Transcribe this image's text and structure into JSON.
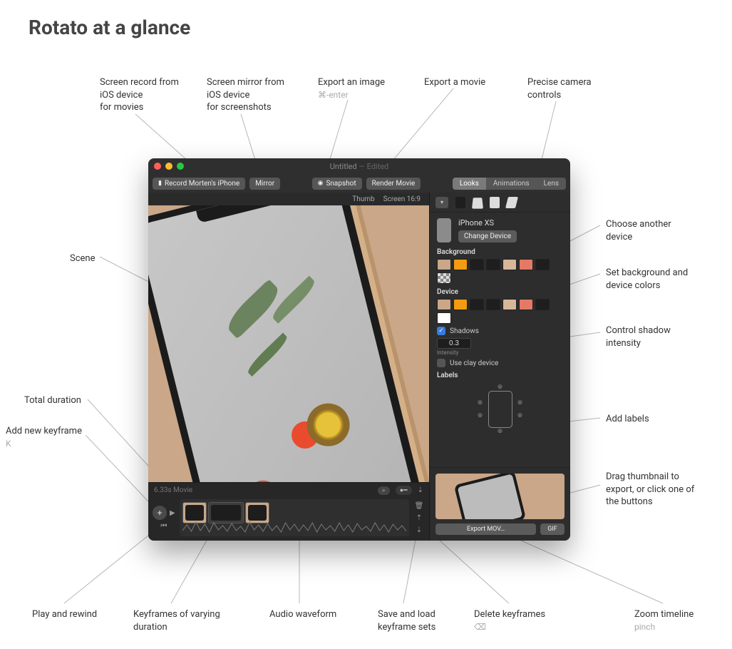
{
  "title": "Rotato at a glance",
  "callouts": {
    "screenRecord": "Screen record from\niOS device\nfor movies",
    "screenMirror": "Screen mirror from\niOS device\nfor screenshots",
    "exportImage": "Export an image",
    "exportImageSub": "⌘-enter",
    "exportMovie": "Export a movie",
    "cameraControls": "Precise camera\ncontrols",
    "scene": "Scene",
    "chooseDevice": "Choose another\ndevice",
    "bgColors": "Set background and\ndevice colors",
    "shadow": "Control shadow\nintensity",
    "totalDuration": "Total duration",
    "addKeyframe": "Add new keyframe",
    "addKeyframeSub": "K",
    "addLabels": "Add labels",
    "dragThumb": "Drag thumbnail to\nexport, or click one of\nthe buttons",
    "playRewind": "Play and rewind",
    "keyframes": "Keyframes of varying\nduration",
    "waveform": "Audio waveform",
    "saveLoad": "Save and load\nkeyframe sets",
    "deleteKf": "Delete keyframes",
    "deleteKfSub": "⌫",
    "zoom": "Zoom timeline",
    "zoomSub": "pinch"
  },
  "window": {
    "title": "Untitled",
    "edited": "— Edited"
  },
  "toolbar": {
    "record": "Record Morten's iPhone",
    "mirror": "Mirror",
    "snapshot": "Snapshot",
    "render": "Render Movie",
    "tabs": {
      "looks": "Looks",
      "animations": "Animations",
      "lens": "Lens"
    }
  },
  "viewport": {
    "thumb": "Thumb",
    "aspect": "Screen 16:9"
  },
  "rightPanel": {
    "deviceName": "iPhone XS",
    "changeDevice": "Change Device",
    "background": "Background",
    "device": "Device",
    "shadows": "Shadows",
    "shadowValue": "0.3",
    "intensity": "Intensity",
    "useClay": "Use clay device",
    "labels": "Labels",
    "exportMov": "Export MOV…",
    "gif": "GIF",
    "bgSwatches": [
      "#c9a788",
      "#f39c12",
      "#1e1e1e",
      "#1e1e1e",
      "#d7b79a",
      "#e47965",
      "#1e1e1e",
      "checker"
    ],
    "devSwatches": [
      "#c9a788",
      "#f39c12",
      "#1e1e1e",
      "#1e1e1e",
      "#d7b79a",
      "#e47965",
      "#1e1e1e",
      "#ffffff"
    ]
  },
  "timeline": {
    "duration": "6.33s Movie"
  }
}
